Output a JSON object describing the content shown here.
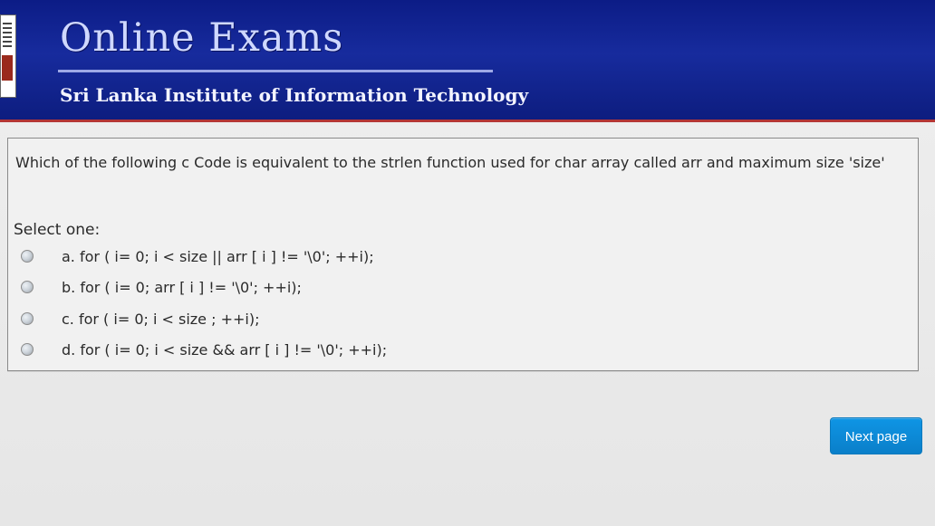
{
  "header": {
    "title": "Online Exams",
    "subtitle": "Sri Lanka Institute of Information Technology"
  },
  "question": {
    "text": "Which of the following c Code is equivalent to the  strlen function used for char array called arr and maximum size 'size'",
    "select_label": "Select one:",
    "options": [
      {
        "label": "a. for (  i= 0; i < size  ||  arr [ i ] != '\\0'; ++i);"
      },
      {
        "label": "b. for (  i= 0; arr [ i ] != '\\0'; ++i);"
      },
      {
        "label": "c. for (  i= 0; i < size ; ++i);"
      },
      {
        "label": "d. for (  i= 0; i < size && arr [ i ] != '\\0'; ++i);"
      }
    ]
  },
  "navigation": {
    "next_label": "Next page"
  },
  "colors": {
    "header_blue": "#172b9d",
    "header_rule": "#9ea9e7",
    "accent_red": "#b43636",
    "button_blue": "#0a7fc9"
  }
}
